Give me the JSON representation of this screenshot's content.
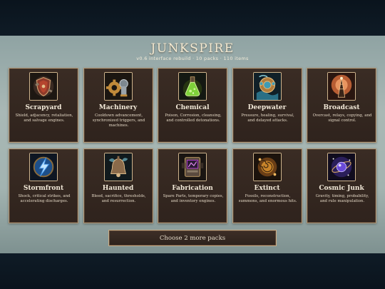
{
  "header": {
    "title": "JUNKSPIRE",
    "subtitle": "v0.6 interface rebuild · 10 packs · 110 items"
  },
  "packs": [
    {
      "name": "Scrapyard",
      "description": "Shield, adjacency, retaliation, and salvage engines.",
      "icon": "scrap-shield-icon",
      "accent": "#b5452e"
    },
    {
      "name": "Machinery",
      "description": "Cooldown advancement, synchronized triggers, and machines.",
      "icon": "gear-piston-icon",
      "accent": "#c08a3a"
    },
    {
      "name": "Chemical",
      "description": "Poison, Corrosion, cleansing, and controlled detonations.",
      "icon": "flask-icon",
      "accent": "#7ed23a"
    },
    {
      "name": "Deepwater",
      "description": "Pressure, healing, survival, and delayed attacks.",
      "icon": "diving-helmet-icon",
      "accent": "#3f9bb5"
    },
    {
      "name": "Broadcast",
      "description": "Overcast, relays, copying, and signal control.",
      "icon": "radio-tower-icon",
      "accent": "#d06a3a"
    },
    {
      "name": "Stormfront",
      "description": "Shock, critical strikes, and accelerating discharges.",
      "icon": "lightning-icon",
      "accent": "#3a8ce0"
    },
    {
      "name": "Haunted",
      "description": "Bleed, sacrifice, thresholds, and resurrection.",
      "icon": "haunted-bell-icon",
      "accent": "#6fb8c8"
    },
    {
      "name": "Fabrication",
      "description": "Spare Parts, temporary copies, and inventory engines.",
      "icon": "fabricator-icon",
      "accent": "#b03ad0"
    },
    {
      "name": "Extinct",
      "description": "Fossils, reconstruction, summons, and enormous hits.",
      "icon": "fossil-icon",
      "accent": "#d8902e"
    },
    {
      "name": "Cosmic Junk",
      "description": "Gravity, timing, probability, and rule manipulation.",
      "icon": "cosmic-orb-icon",
      "accent": "#6a4ad8"
    }
  ],
  "footer": {
    "choose_label": "Choose 2 more packs"
  }
}
